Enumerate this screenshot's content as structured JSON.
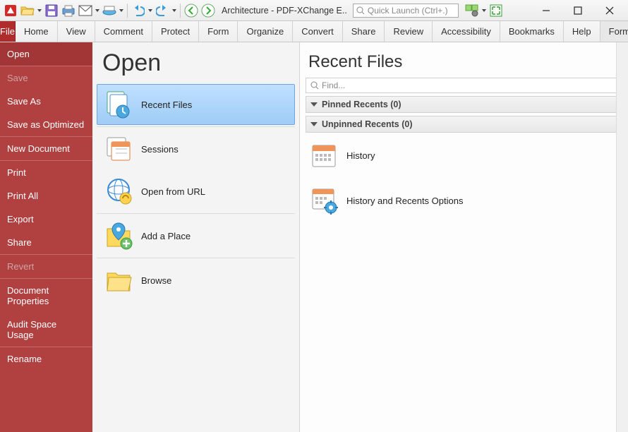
{
  "title": "Architecture - PDF-XChange E..",
  "quick_launch_placeholder": "Quick Launch (Ctrl+.)",
  "ribbon": {
    "file": "File",
    "tabs": [
      "Home",
      "View",
      "Comment",
      "Protect",
      "Form",
      "Organize",
      "Convert",
      "Share",
      "Review",
      "Accessibility",
      "Bookmarks",
      "Help",
      "Format"
    ],
    "active_tab": "Format"
  },
  "backstage_sidebar": [
    {
      "label": "Open",
      "state": "active"
    },
    {
      "label": "Save",
      "state": "disabled"
    },
    {
      "label": "Save As",
      "state": "normal"
    },
    {
      "label": "Save as Optimized",
      "state": "normal"
    },
    {
      "label": "New Document",
      "state": "normal"
    },
    {
      "label": "Print",
      "state": "normal"
    },
    {
      "label": "Print All",
      "state": "normal"
    },
    {
      "label": "Export",
      "state": "normal"
    },
    {
      "label": "Share",
      "state": "normal"
    },
    {
      "label": "Revert",
      "state": "disabled"
    },
    {
      "label": "Document Properties",
      "state": "normal"
    },
    {
      "label": "Audit Space Usage",
      "state": "normal"
    },
    {
      "label": "Rename",
      "state": "normal"
    }
  ],
  "backstage_dividers_after": [
    0,
    3,
    4,
    8,
    9,
    11
  ],
  "open_panel": {
    "title": "Open",
    "items": [
      {
        "label": "Recent Files",
        "icon": "recent-files-icon",
        "selected": true
      },
      {
        "label": "Sessions",
        "icon": "sessions-icon"
      },
      {
        "label": "Open from URL",
        "icon": "globe-link-icon"
      },
      {
        "label": "Add a Place",
        "icon": "add-place-icon"
      },
      {
        "label": "Browse",
        "icon": "folder-icon"
      }
    ],
    "dividers_after": [
      0,
      2,
      3
    ]
  },
  "recent_panel": {
    "title": "Recent Files",
    "find_placeholder": "Find...",
    "sections": [
      {
        "label": "Pinned Recents (0)"
      },
      {
        "label": "Unpinned Recents (0)"
      }
    ],
    "entries": [
      {
        "label": "History",
        "icon": "calendar-icon"
      },
      {
        "label": "History and Recents Options",
        "icon": "calendar-gear-icon"
      }
    ]
  }
}
